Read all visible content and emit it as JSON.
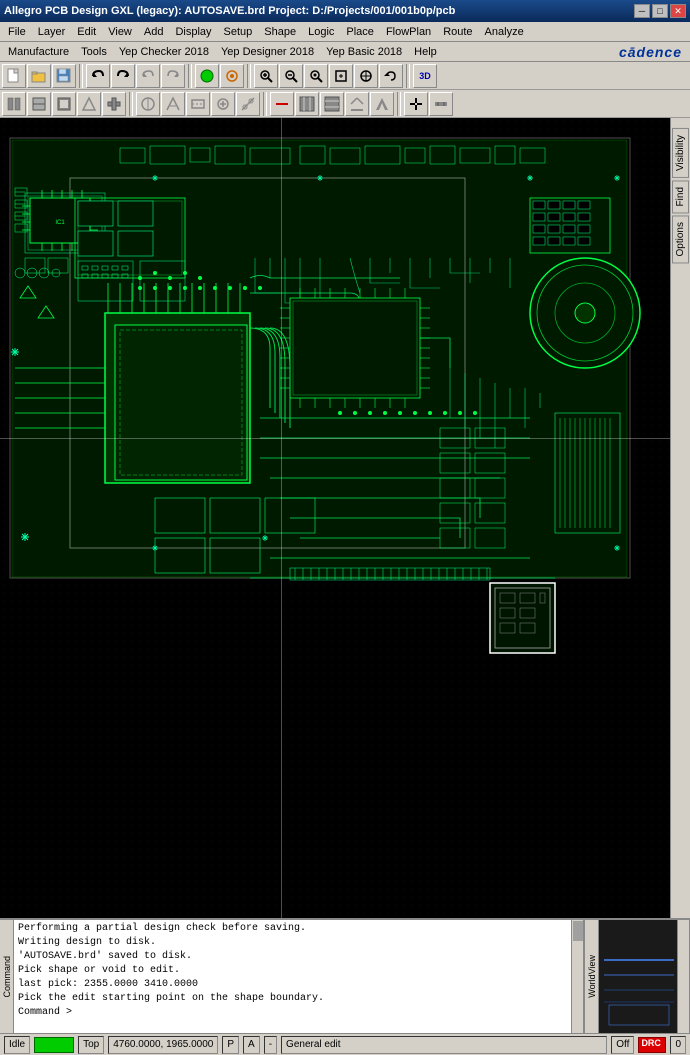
{
  "titlebar": {
    "title": "Allegro PCB Design GXL (legacy): AUTOSAVE.brd  Project: D:/Projects/001/001b0p/pcb",
    "min_btn": "─",
    "max_btn": "□",
    "close_btn": "✕"
  },
  "menubar1": {
    "items": [
      "File",
      "Layer",
      "Edit",
      "View",
      "Add",
      "Display",
      "Setup",
      "Shape",
      "Logic",
      "Place",
      "FlowPlan",
      "Route",
      "Analyze"
    ]
  },
  "menubar2": {
    "items": [
      "Manufacture",
      "Tools",
      "Yep Checker 2018",
      "Yep Designer 2018",
      "Yep Basic 2018",
      "Help"
    ],
    "logo": "cadence"
  },
  "toolbar1": {
    "buttons": [
      "new",
      "open",
      "save",
      "tb-sep",
      "undo1",
      "redo1",
      "tb-sep",
      "add-connect",
      "add-ratsnest",
      "tb-sep",
      "zoom-in",
      "zoom-out",
      "zoom-fit",
      "tb-sep",
      "spin",
      "mirror",
      "flip",
      "tb-sep",
      "3d"
    ]
  },
  "toolbar2": {
    "buttons": [
      "b1",
      "b2",
      "b3",
      "b4",
      "b5",
      "tb-sep",
      "b6",
      "b7",
      "b8",
      "b9",
      "b10",
      "tb-sep",
      "b11",
      "b12",
      "b13",
      "b14",
      "b15",
      "tb-sep",
      "b16"
    ]
  },
  "right_panel": {
    "tabs": [
      "Visibility",
      "Find",
      "Options"
    ]
  },
  "log_panel": {
    "label": "Command",
    "lines": [
      "Performing a partial design check before saving.",
      "Writing design to disk.",
      "'AUTOSAVE.brd' saved to disk.",
      "Pick shape or void to edit.",
      "last pick:  2355.0000 3410.0000",
      "Pick the edit starting point on the shape boundary.",
      "Command >"
    ]
  },
  "worldview": {
    "label": "WorldView"
  },
  "statusbar": {
    "idle": "Idle",
    "green_indicator": "",
    "layer": "Top",
    "coords": "4760.0000, 1965.0000",
    "coord_units": "P",
    "snap": "A",
    "separator": "-",
    "mode": "General edit",
    "off_label": "Off",
    "drc_label": "DRC",
    "counter": "0"
  }
}
